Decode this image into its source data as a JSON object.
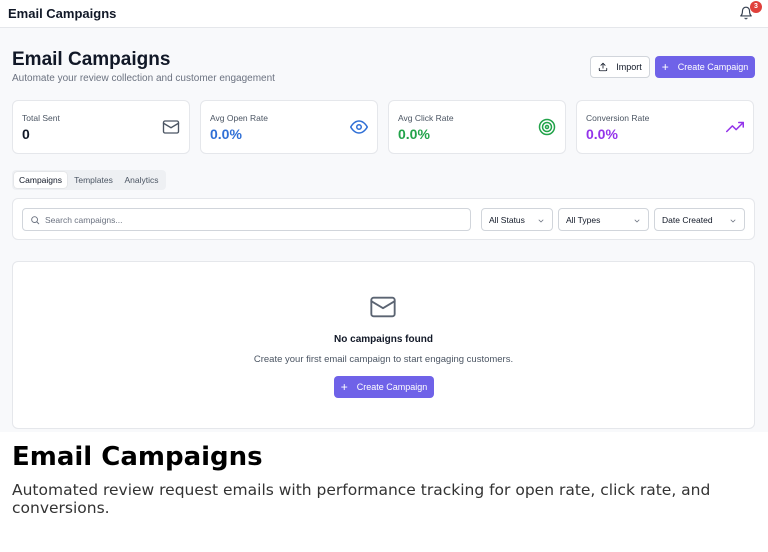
{
  "header": {
    "app_title": "Email Campaigns",
    "notification_count": "3"
  },
  "page": {
    "title": "Email Campaigns",
    "subtitle": "Automate your review collection and customer engagement"
  },
  "actions": {
    "import_label": "Import",
    "create_label": "Create Campaign"
  },
  "stats": [
    {
      "label": "Total Sent",
      "value": "0",
      "icon": "mail-icon",
      "color": "#111827"
    },
    {
      "label": "Avg Open Rate",
      "value": "0.0%",
      "icon": "eye-icon",
      "color": "#2f6fd6"
    },
    {
      "label": "Avg Click Rate",
      "value": "0.0%",
      "icon": "target-icon",
      "color": "#22a34a"
    },
    {
      "label": "Conversion Rate",
      "value": "0.0%",
      "icon": "trending-up-icon",
      "color": "#9333ea"
    }
  ],
  "tabs": [
    {
      "label": "Campaigns",
      "active": true
    },
    {
      "label": "Templates",
      "active": false
    },
    {
      "label": "Analytics",
      "active": false
    }
  ],
  "filters": {
    "search_placeholder": "Search campaigns...",
    "search_value": "",
    "status": "All Status",
    "type": "All Types",
    "sort": "Date Created"
  },
  "empty_state": {
    "title": "No campaigns found",
    "subtitle": "Create your first email campaign to start engaging customers.",
    "button_label": "Create Campaign"
  },
  "caption": {
    "title": "Email Campaigns",
    "body": "Automated review request emails with performance tracking for open rate, click rate, and conversions."
  },
  "colors": {
    "accent": "#6f62e8",
    "badge": "#e0403b"
  }
}
